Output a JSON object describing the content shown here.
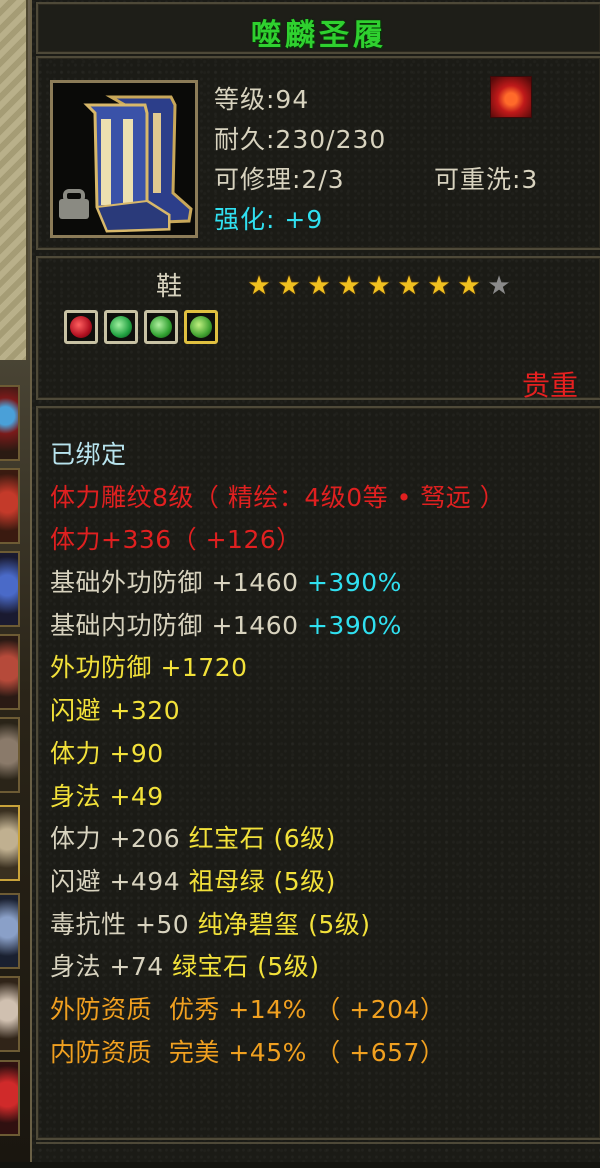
{
  "item": {
    "name": "噬麟圣履",
    "level": "等级:94",
    "durability": "耐久:230/230",
    "repair": "可修理:2/3",
    "rewash": "可重洗:3",
    "enhance_label": "强化:",
    "enhance_value": "+9",
    "type": "鞋",
    "stars_filled": 8,
    "stars_total": 9,
    "rarity": "贵重",
    "icon": "blue-boots-icon",
    "badge_icon": "flame-badge-icon"
  },
  "gems": [
    {
      "name": "ruby-gem-icon"
    },
    {
      "name": "emerald-gem-icon"
    },
    {
      "name": "jade-gem-icon"
    },
    {
      "name": "green-gem-icon"
    }
  ],
  "attributes": [
    {
      "segments": [
        {
          "text": "已绑定",
          "color": "#b8e4ee"
        }
      ]
    },
    {
      "segments": [
        {
          "text": "体力雕纹8级（ 精绘：4级0等 • 驽远 ）",
          "color": "#e02020"
        }
      ]
    },
    {
      "segments": [
        {
          "text": "体力+336（ +126）",
          "color": "#e02020"
        }
      ]
    },
    {
      "segments": [
        {
          "text": "基础外功防御 +1460 ",
          "color": "#d8d3bf"
        },
        {
          "text": "+390%",
          "color": "#30e0f0"
        }
      ]
    },
    {
      "segments": [
        {
          "text": "基础内功防御 +1460 ",
          "color": "#d8d3bf"
        },
        {
          "text": "+390%",
          "color": "#30e0f0"
        }
      ]
    },
    {
      "segments": [
        {
          "text": "外功防御 +1720",
          "color": "#f2e13a"
        }
      ]
    },
    {
      "segments": [
        {
          "text": "闪避 +320",
          "color": "#f2e13a"
        }
      ]
    },
    {
      "segments": [
        {
          "text": "体力 +90",
          "color": "#f2e13a"
        }
      ]
    },
    {
      "segments": [
        {
          "text": "身法 +49",
          "color": "#f2e13a"
        }
      ]
    },
    {
      "segments": [
        {
          "text": "体力 +206 ",
          "color": "#d8d3bf"
        },
        {
          "text": "红宝石 (6级)",
          "color": "#f2e13a"
        }
      ]
    },
    {
      "segments": [
        {
          "text": "闪避 +494 ",
          "color": "#d8d3bf"
        },
        {
          "text": "祖母绿 (5级)",
          "color": "#f2e13a"
        }
      ]
    },
    {
      "segments": [
        {
          "text": "毒抗性 +50 ",
          "color": "#d8d3bf"
        },
        {
          "text": "纯净碧玺 (5级)",
          "color": "#f2e13a"
        }
      ]
    },
    {
      "segments": [
        {
          "text": "身法 +74 ",
          "color": "#d8d3bf"
        },
        {
          "text": "绿宝石 (5级)",
          "color": "#f2e13a"
        }
      ]
    },
    {
      "segments": [
        {
          "text": "外防资质  优秀 +14% （ +204）",
          "color": "#f0a020"
        }
      ]
    },
    {
      "segments": [
        {
          "text": "内防资质  完美 +45% （ +657）",
          "color": "#f0a020"
        }
      ]
    }
  ],
  "colors": {
    "name_green": "#2fd02f",
    "enhance_cyan": "#30e0f0",
    "rarity_red": "#e62020",
    "gold_yellow": "#f2e13a",
    "orange": "#f0a020"
  }
}
